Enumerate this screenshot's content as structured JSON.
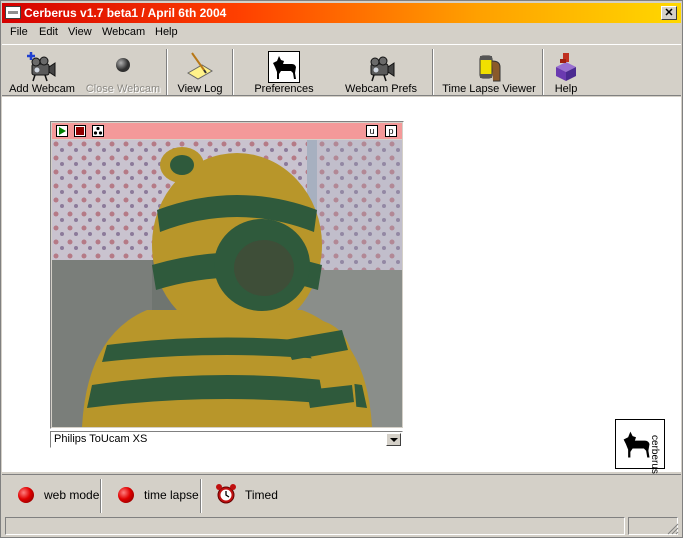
{
  "window": {
    "title": "Cerberus v1.7 beta1 / April 6th 2004",
    "close_glyph": "✕"
  },
  "menu": [
    {
      "label": "File"
    },
    {
      "label": "Edit"
    },
    {
      "label": "View"
    },
    {
      "label": "Webcam"
    },
    {
      "label": "Help"
    }
  ],
  "toolbar": {
    "add_webcam": "Add Webcam",
    "close_webcam": "Close Webcam",
    "view_log": "View Log",
    "preferences": "Preferences",
    "webcam_prefs": "Webcam Prefs",
    "time_lapse_viewer": "Time Lapse Viewer",
    "help": "Help"
  },
  "camera": {
    "selected_device": "Philips ToUcam XS",
    "header_buttons": [
      "play",
      "stop",
      "snapshot",
      "u",
      "p"
    ],
    "header_letters": {
      "u": "u",
      "p": "p"
    }
  },
  "logo": {
    "text": "cerberus"
  },
  "status": {
    "web_mode": "web mode",
    "time_lapse": "time lapse",
    "timed": "Timed"
  },
  "colors": {
    "title_start": "#d40000",
    "title_end": "#ffd800",
    "camera_header": "#f49999",
    "indicator_red": "#e00000"
  }
}
